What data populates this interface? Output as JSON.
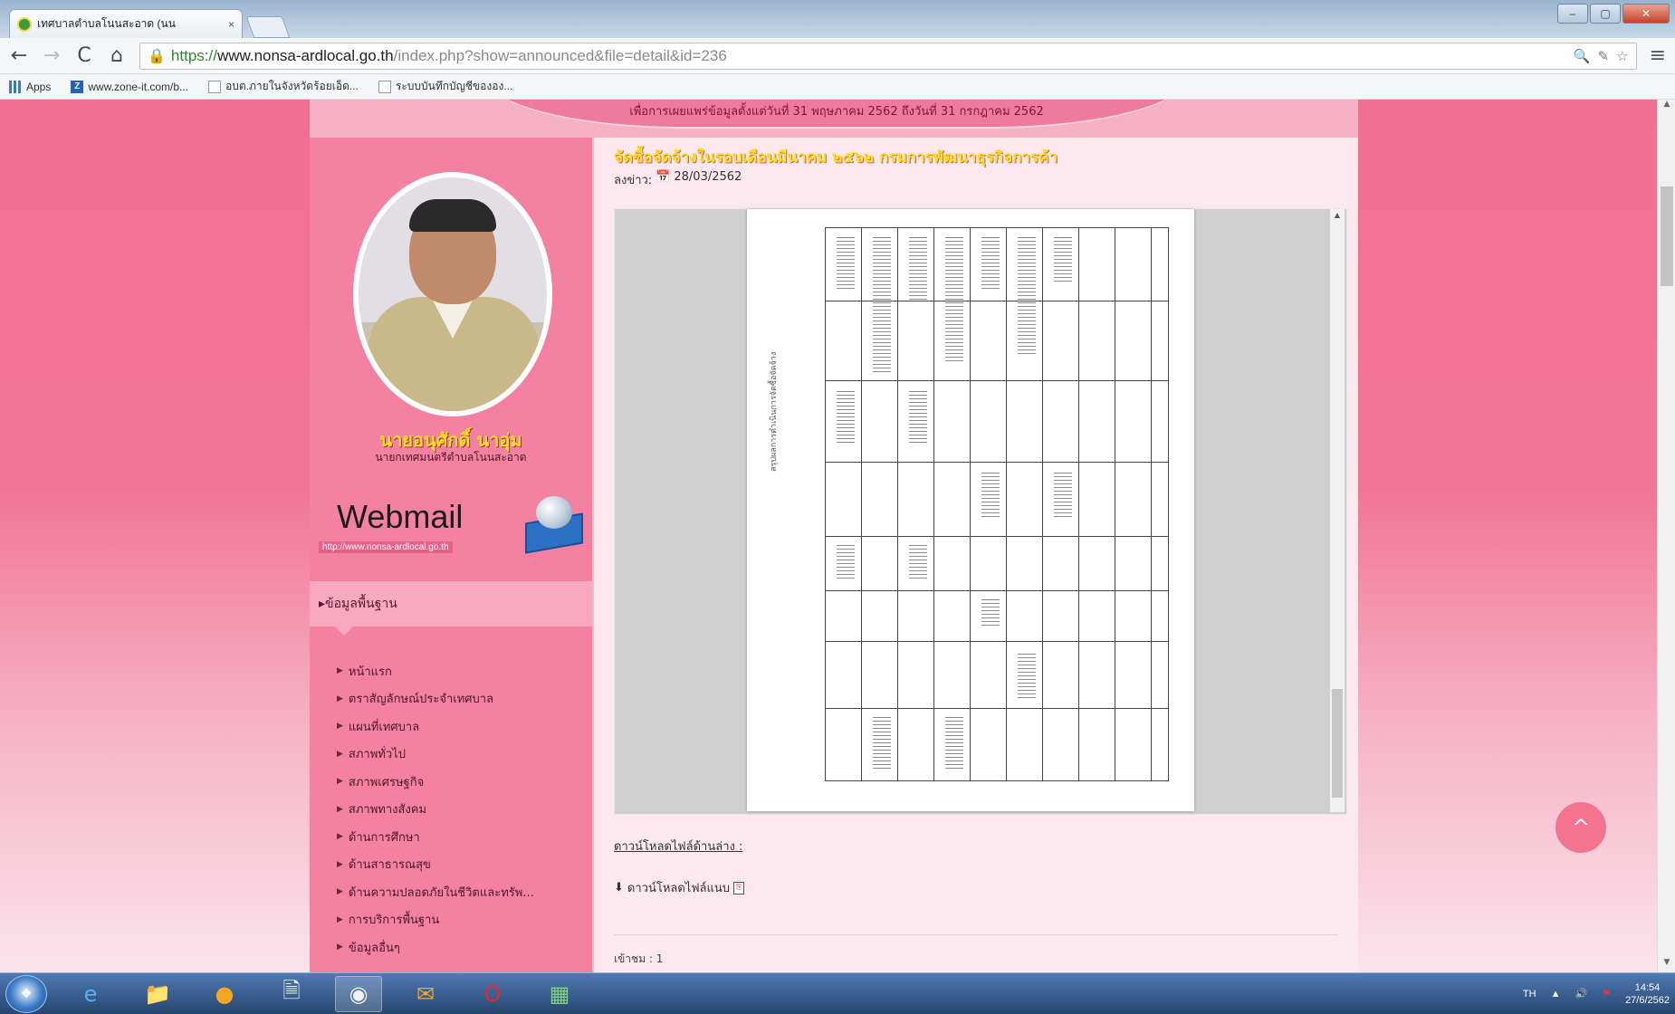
{
  "browser": {
    "tab_title": "เทศบาลตำบลโนนสะอาด (นน",
    "tab_close": "×",
    "window_buttons": {
      "minimize": "–",
      "maximize": "▢",
      "close": "✕"
    },
    "nav": {
      "back": "←",
      "forward": "→",
      "reload": "C",
      "home": "⌂"
    },
    "url_scheme": "https://",
    "url_host": "www.nonsa-ardlocal.go.th",
    "url_path": "/index.php?show=announced&file=detail&id=236",
    "omnibox_icons": [
      "🔍",
      "✎",
      "☆"
    ],
    "menu_icon": "≡",
    "bookmarks": [
      {
        "label": "Apps",
        "icon": "apps-icon"
      },
      {
        "label": "www.zone-it.com/b...",
        "icon": "zone-it-icon"
      },
      {
        "label": "อบต.ภายในจังหวัดร้อยเอ็ด...",
        "icon": "page-icon"
      },
      {
        "label": "ระบบบันทึกบัญชีขององ...",
        "icon": "page-icon"
      }
    ]
  },
  "site": {
    "banner_text": "เพื่อการเผยแพร่ข้อมูลตั้งแต่วันที่ 31 พฤษภาคม 2562 ถึงวันที่ 31 กรกฎาคม 2562",
    "mayor_name": "นายอนุศักดิ์ นาอุ่ม",
    "mayor_title": "นายกเทศมนตรีตำบลโนนสะอาด",
    "webmail_label": "Webmail",
    "webmail_url": "http://www.nonsa-ardlocal.go.th",
    "menu_header": "ข้อมูลพื้นฐาน",
    "menu_items": [
      "หน้าแรก",
      "ตราสัญลักษณ์ประจำเทศบาล",
      "แผนที่เทศบาล",
      "สภาพทั่วไป",
      "สภาพเศรษฐกิจ",
      "สภาพทางสังคม",
      "ด้านการศึกษา",
      "ด้านสาธารณสุข",
      "ด้านความปลอดภัยในชีวิตและทรัพ...",
      "การบริการพื้นฐาน",
      "ข้อมูลอื่นๆ"
    ],
    "article_title": "จัดซื้อจัดจ้างในรอบเดือนมีนาคม ๒๕๖๒ กรมการพัฒนาธุรกิจการค้า",
    "date_label": "ลงข่าว:",
    "date": "28/03/2562",
    "doc_heading": "สรุปผลการดำเนินการจัดซื้อจัดจ้าง",
    "download_heading": "ดาวน์โหลดไฟล์ด้านล่าง :",
    "download_link": "ดาวน์โหลดไฟล์แนบ",
    "views": "เข้าชม : 1",
    "back_to_top": "^"
  },
  "taskbar": {
    "apps": [
      "start",
      "internet-explorer",
      "file-explorer",
      "media-player",
      "notepad",
      "chrome",
      "outlook",
      "opera",
      "excel"
    ],
    "lang": "TH",
    "time": "14:54",
    "date": "27/6/2562"
  }
}
